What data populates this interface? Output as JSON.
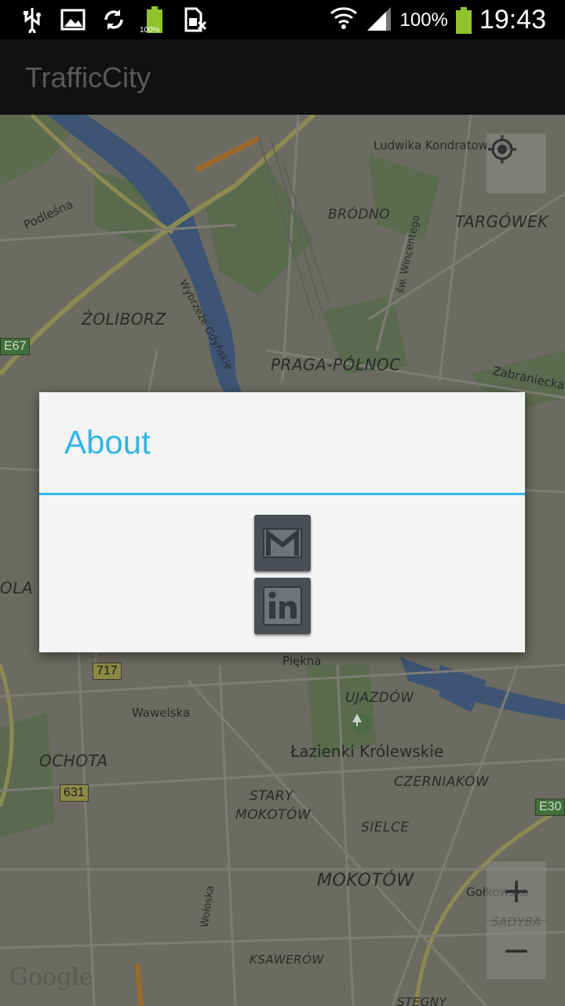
{
  "status_bar": {
    "icons": [
      "usb-icon",
      "image-icon",
      "sync-icon",
      "battery-small-icon",
      "sim-icon"
    ],
    "battery_small_label": "100%",
    "right_icons": [
      "wifi-icon",
      "signal-icon"
    ],
    "battery_percent": "100%",
    "time": "19:43",
    "battery_color": "#8fc32b"
  },
  "action_bar": {
    "title": "TrafficCity"
  },
  "map": {
    "labels": {
      "ludwika": "Ludwika Kondratowicza",
      "brodno": "BRÓDNO",
      "targowek": "TARGÓWEK",
      "podlesna": "Podleśna",
      "wincentego": "św. Wincentego",
      "zoliborz": "ŻOLIBORZ",
      "wybrzeze": "Wybrzeże Gdyńskie",
      "praga": "PRAGA-PÓŁNOC",
      "zabraniecka": "Zabraniecka",
      "ola": "OLA",
      "piekna": "Piękna",
      "ujazdow": "UJAZDÓW",
      "wawelska": "Wawelska",
      "lazienki": "Łazienki Królewskie",
      "ochota": "OCHOTA",
      "stary_mokotow_1": "STARY",
      "stary_mokotow_2": "MOKOTÓW",
      "czerniakow": "CZERNIAKÓW",
      "sielce": "SIELCE",
      "mokotow": "MOKOTÓW",
      "golkowska": "Gołkowska",
      "sadyba": "SADYBA",
      "woloska": "Wołoska",
      "ksawerow": "KSAWERÓW",
      "stegny": "STEGNY"
    },
    "shields": {
      "e67": "E67",
      "r717": "717",
      "r631": "631",
      "e30": "E30"
    },
    "zoom_in": "+",
    "zoom_out": "−",
    "attribution": "Google"
  },
  "dialog": {
    "title": "About",
    "accent_color": "#33b5e5",
    "buttons": [
      "gmail-icon",
      "linkedin-icon"
    ]
  }
}
